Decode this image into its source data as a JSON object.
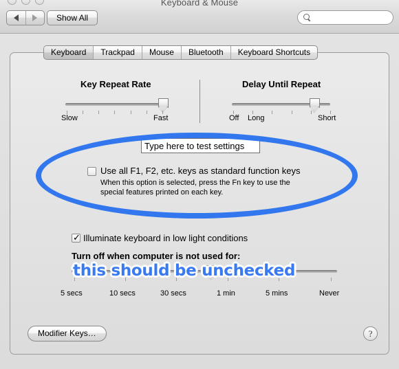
{
  "window": {
    "title": "Keyboard & Mouse",
    "traffic_lights": [
      "close",
      "minimize",
      "zoom"
    ]
  },
  "toolbar": {
    "back_label": "back",
    "forward_label": "forward",
    "show_all_label": "Show All",
    "search": {
      "value": "",
      "placeholder": "",
      "icon": "search-icon"
    }
  },
  "tabs": [
    {
      "label": "Keyboard",
      "selected": true
    },
    {
      "label": "Trackpad",
      "selected": false
    },
    {
      "label": "Mouse",
      "selected": false
    },
    {
      "label": "Bluetooth",
      "selected": false
    },
    {
      "label": "Keyboard Shortcuts",
      "selected": false
    }
  ],
  "sliders": {
    "key_repeat_rate": {
      "title": "Key Repeat Rate",
      "tick_count": 7,
      "value_index": 6,
      "labels": [
        {
          "text": "Slow",
          "tick": 0
        },
        {
          "text": "Fast",
          "tick": 6
        }
      ]
    },
    "delay_until_repeat": {
      "title": "Delay Until Repeat",
      "tick_count": 6,
      "value_index": 4,
      "labels": [
        {
          "text": "Off",
          "tick": 0
        },
        {
          "text": "Long",
          "tick": 1
        },
        {
          "text": "Short",
          "tick": 5
        }
      ]
    },
    "turn_off_delay": {
      "title": "Turn off when computer is not used for:",
      "tick_count": 6,
      "value_index": 3,
      "labels": [
        {
          "text": "5 secs",
          "tick": 0
        },
        {
          "text": "10 secs",
          "tick": 1
        },
        {
          "text": "30 secs",
          "tick": 2
        },
        {
          "text": "1 min",
          "tick": 3
        },
        {
          "text": "5 mins",
          "tick": 4
        },
        {
          "text": "Never",
          "tick": 5
        }
      ]
    }
  },
  "test_field": {
    "value": "Type here to test settings",
    "placeholder": "Type here to test settings"
  },
  "function_keys": {
    "label": "Use all F1, F2, etc. keys as standard function keys",
    "checked": false,
    "help_line1": "When this option is selected, press the Fn key to use the",
    "help_line2": "special features printed on each key."
  },
  "illuminate": {
    "label": "Illuminate keyboard in low light conditions",
    "checked": true,
    "check_glyph": "✓"
  },
  "buttons": {
    "modifier_keys": "Modifier Keys…",
    "help": "?"
  },
  "annotations": {
    "ellipse": {
      "name": "highlight-ellipse",
      "color": "#3377ee"
    },
    "note": {
      "text": "this should be unchecked",
      "color": "#3a7af0",
      "outline_color": "#ffffff"
    }
  }
}
